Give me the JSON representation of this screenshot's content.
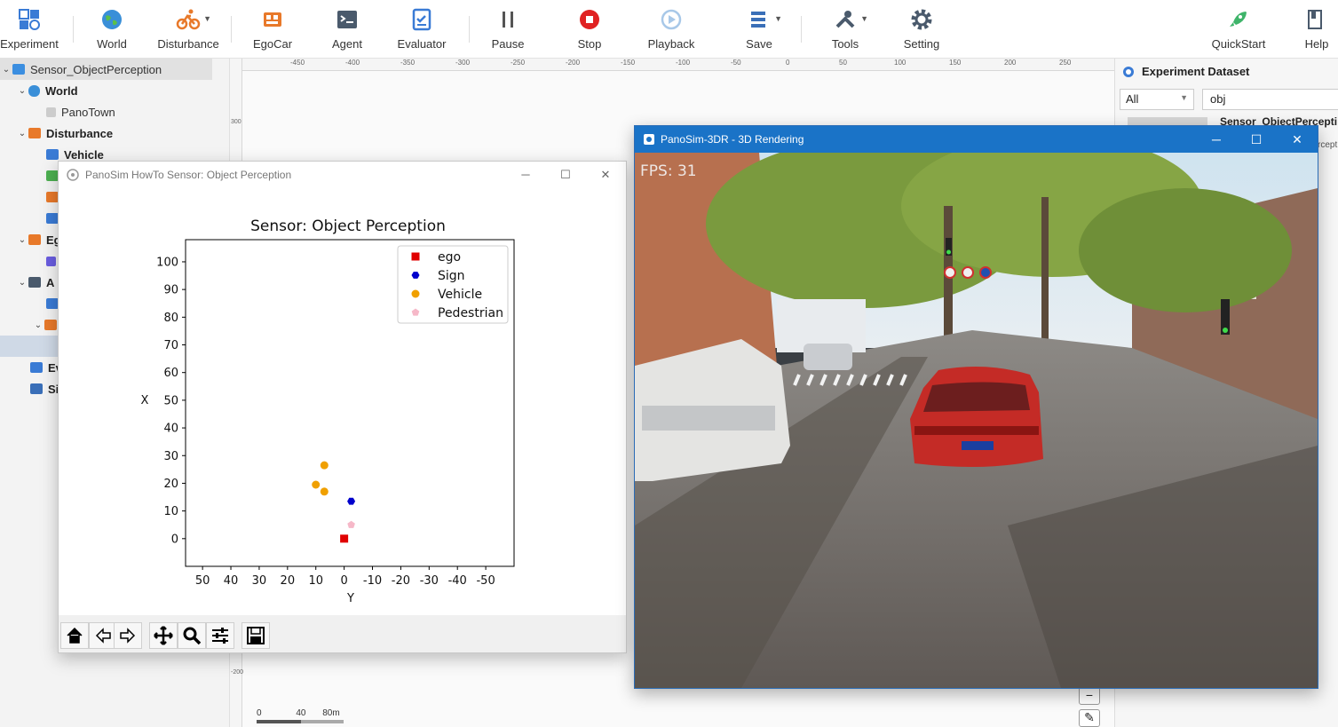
{
  "toolbar": {
    "experiment": "Experiment",
    "world": "World",
    "disturbance": "Disturbance",
    "egocar": "EgoCar",
    "agent": "Agent",
    "evaluator": "Evaluator",
    "pause": "Pause",
    "stop": "Stop",
    "playback": "Playback",
    "save": "Save",
    "tools": "Tools",
    "setting": "Setting",
    "quickstart": "QuickStart",
    "help": "Help"
  },
  "tree": {
    "root": "Sensor_ObjectPerception",
    "world": "World",
    "panotown": "PanoTown",
    "disturbance": "Disturbance",
    "vehicle": "Vehicle",
    "ego_partial": "Eg",
    "agent_partial": "A",
    "eval_partial": "Ev",
    "sim_partial": "Si"
  },
  "ruler": {
    "top_ticks": [
      "350",
      "-450",
      "-400",
      "-350",
      "-300",
      "-250",
      "-200",
      "-150",
      "-100",
      "-50",
      "0",
      "50",
      "100",
      "150",
      "200",
      "250"
    ],
    "left_ticks": [
      "300",
      "-200"
    ],
    "scale": [
      "0",
      "40",
      "80m"
    ]
  },
  "right_panel": {
    "title": "Experiment Dataset",
    "filter": "All",
    "search_value": "obj",
    "item_title": "Sensor_ObjectPercepti",
    "item_sub": "rcept"
  },
  "mpl_window": {
    "title": "PanoSim HowTo Sensor: Object Perception"
  },
  "chart_data": {
    "type": "scatter",
    "title": "Sensor: Object Perception",
    "xlabel": "Y",
    "ylabel": "X",
    "xlim": [
      56,
      -60
    ],
    "ylim": [
      -10,
      108
    ],
    "xticks": [
      50,
      40,
      30,
      20,
      10,
      0,
      -10,
      -20,
      -30,
      -40,
      -50
    ],
    "yticks": [
      0,
      10,
      20,
      30,
      40,
      50,
      60,
      70,
      80,
      90,
      100
    ],
    "legend_position": "upper right",
    "series": [
      {
        "name": "ego",
        "marker": "square",
        "color": "#e00000",
        "points": [
          [
            0,
            0
          ]
        ]
      },
      {
        "name": "Sign",
        "marker": "hexagon",
        "color": "#0000cc",
        "points": [
          [
            -2.5,
            13.5
          ]
        ]
      },
      {
        "name": "Vehicle",
        "marker": "circle",
        "color": "#f0a000",
        "points": [
          [
            7,
            26.5
          ],
          [
            10,
            19.5
          ],
          [
            7,
            17
          ]
        ]
      },
      {
        "name": "Pedestrian",
        "marker": "pentagon",
        "color": "#f6b8c8",
        "points": [
          [
            -2.5,
            5
          ]
        ]
      }
    ]
  },
  "render_window": {
    "title": "PanoSim-3DR - 3D Rendering",
    "fps": "FPS: 31"
  }
}
